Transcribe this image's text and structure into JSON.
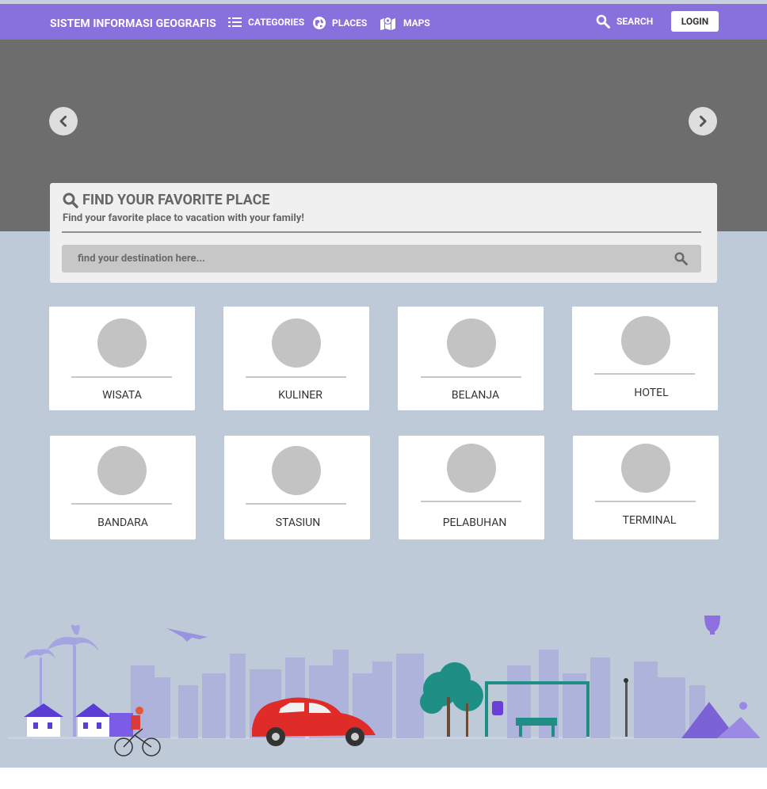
{
  "navbar": {
    "brand": "SISTEM INFORMASI GEOGRAFIS",
    "categories_label": "CATEGORIES",
    "places_label": "PLACES",
    "maps_label": "MAPS",
    "search_label": "SEARCH",
    "login_label": "LOGIN",
    "background_color": "#8870dd"
  },
  "finder": {
    "title": "FIND YOUR FAVORITE PLACE",
    "subtitle": "Find your favorite place to vacation with your family!",
    "placeholder": "find your destination here..."
  },
  "categories": [
    {
      "label": "WISATA"
    },
    {
      "label": "KULINER"
    },
    {
      "label": "BELANJA"
    },
    {
      "label": "HOTEL"
    },
    {
      "label": "BANDARA"
    },
    {
      "label": "STASIUN"
    },
    {
      "label": "PELABUHAN"
    },
    {
      "label": "TERMINAL"
    }
  ],
  "icons": {
    "categories": "list-icon",
    "places": "globe-icon",
    "maps": "map-icon",
    "search": "search-icon",
    "prev": "chevron-left-icon",
    "next": "chevron-right-icon"
  }
}
